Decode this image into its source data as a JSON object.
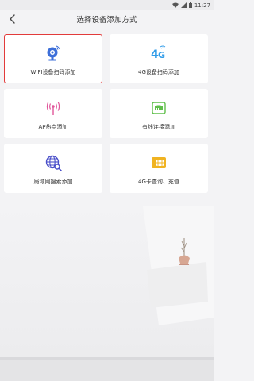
{
  "status": {
    "time": "11:27"
  },
  "header": {
    "title": "选择设备添加方式",
    "back_icon": "back-arrow-icon"
  },
  "options": [
    {
      "id": "wifi",
      "label": "WIFI设备扫码添加",
      "icon": "wifi-camera-icon",
      "color": "#3d6fd9",
      "selected": true
    },
    {
      "id": "4g",
      "label": "4G设备扫码添加",
      "icon": "4g-icon",
      "color": "#2f9be8",
      "selected": false
    },
    {
      "id": "ap",
      "label": "AP热点添加",
      "icon": "hotspot-icon",
      "color": "#e0569a",
      "selected": false
    },
    {
      "id": "wired",
      "label": "有线连接添加",
      "icon": "ethernet-icon",
      "color": "#5fbf4a",
      "selected": false
    },
    {
      "id": "lan",
      "label": "局域网搜索添加",
      "icon": "lan-search-icon",
      "color": "#4a4fc9",
      "selected": false
    },
    {
      "id": "sim",
      "label": "4G卡查询、充值",
      "icon": "sim-card-icon",
      "color": "#f0b321",
      "selected": false
    }
  ]
}
